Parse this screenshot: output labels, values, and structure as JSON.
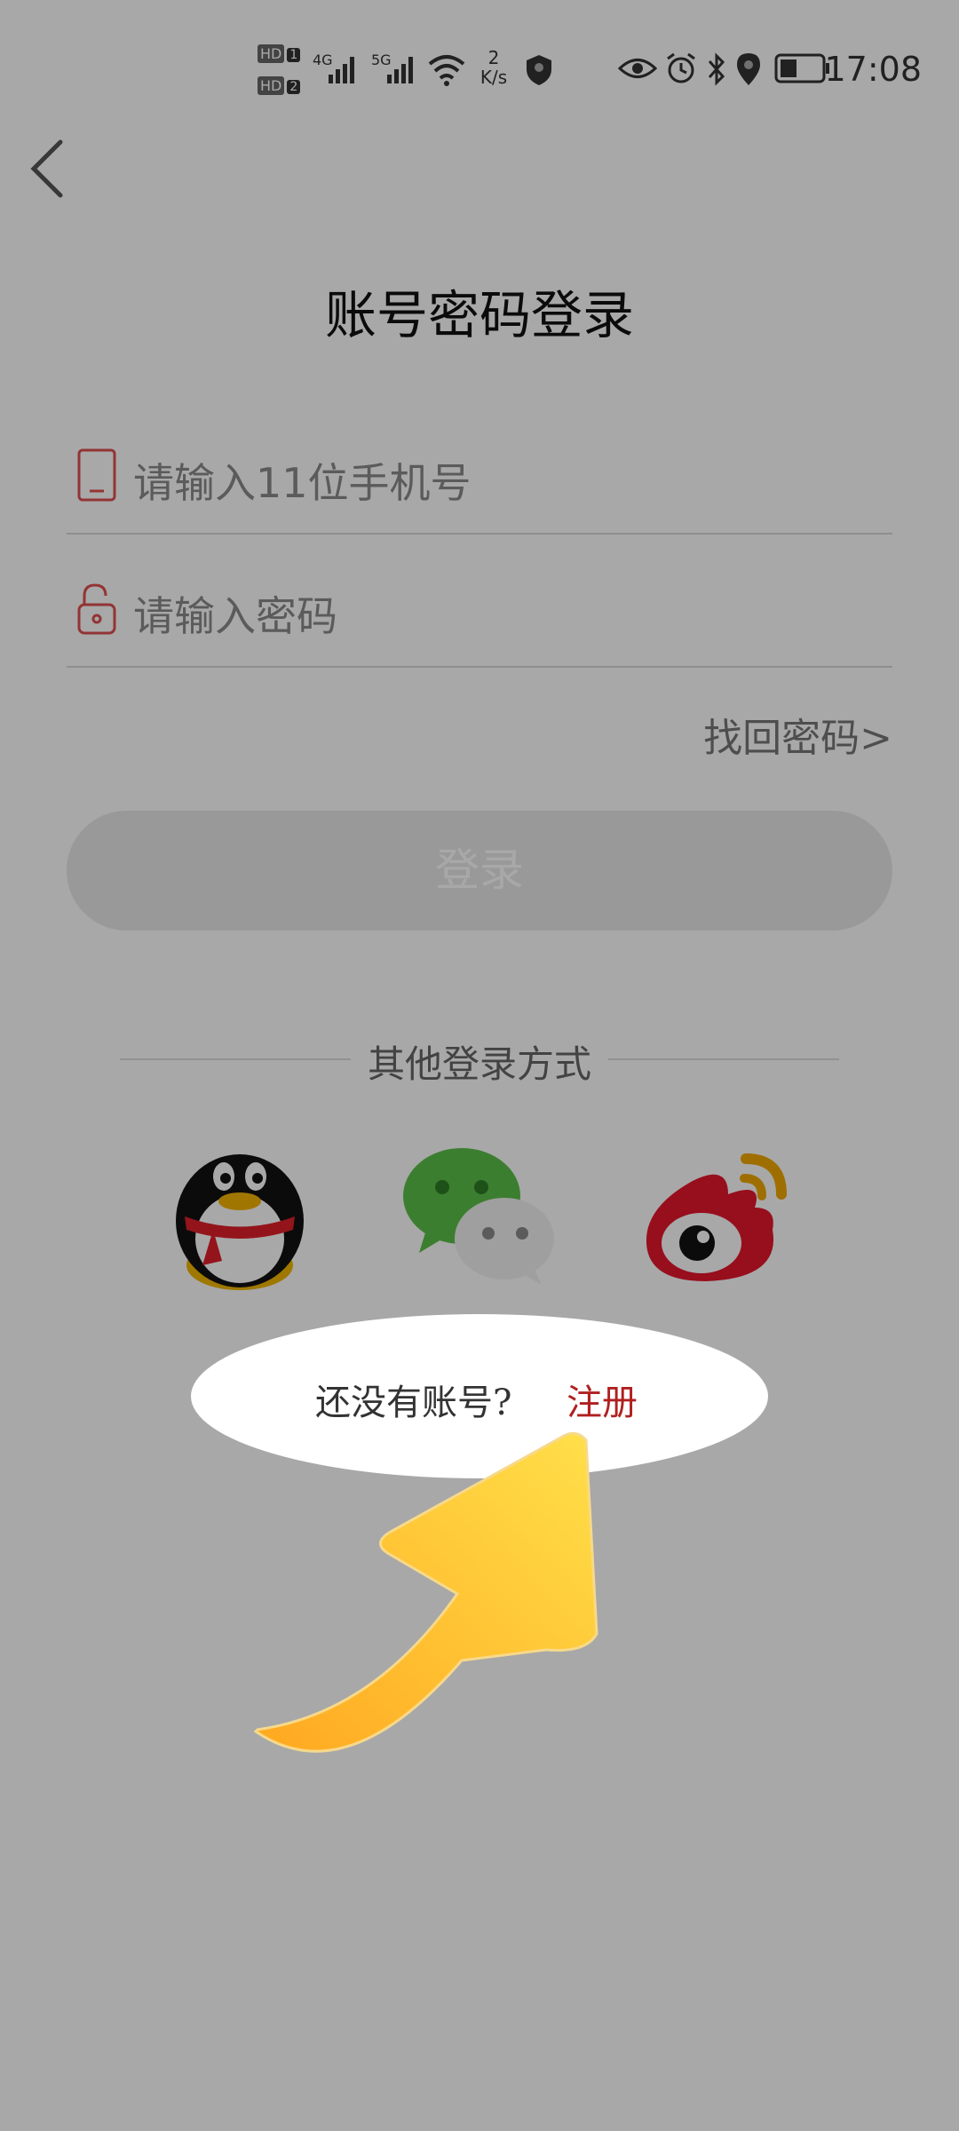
{
  "status_bar": {
    "hd1": "HD",
    "hd1_num": "1",
    "hd2": "HD",
    "hd2_num": "2",
    "sig1": "4G",
    "sig2": "5G",
    "speed_value": "2",
    "speed_unit": "K/s",
    "time": "17:08",
    "icons": [
      "signal-icon",
      "wifi-icon",
      "vpn-shield-icon",
      "eye-icon",
      "alarm-icon",
      "bluetooth-icon",
      "location-icon",
      "battery-icon"
    ]
  },
  "page": {
    "title": "账号密码登录"
  },
  "phone_field": {
    "placeholder": "请输入11位手机号"
  },
  "password_field": {
    "placeholder": "请输入密码"
  },
  "forgot_link": "找回密码>",
  "login_button": "登录",
  "other_login": {
    "label": "其他登录方式",
    "providers": [
      "qq-icon",
      "wechat-icon",
      "weibo-icon"
    ]
  },
  "register_prompt": {
    "text": "还没有账号?",
    "link": "注册"
  },
  "colors": {
    "accent": "#b02020",
    "overlay": "#aaaaaa",
    "arrow": "#ffc83a"
  }
}
